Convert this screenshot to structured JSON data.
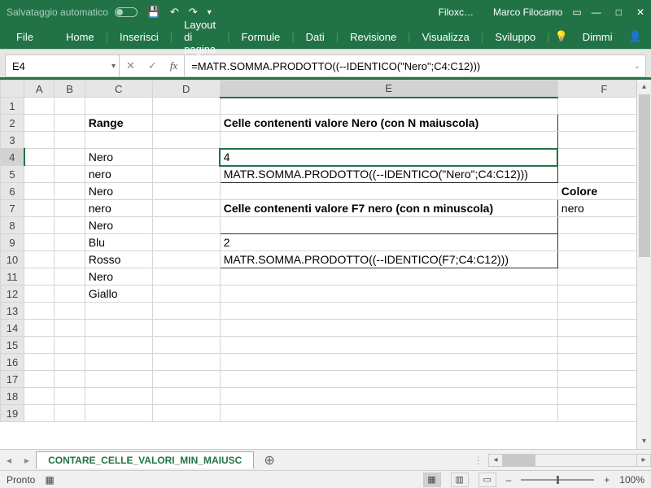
{
  "titlebar": {
    "autosave_label": "Salvataggio automatico",
    "doc_name": "Filoxc…",
    "user_name": "Marco Filocamo"
  },
  "ribbon": {
    "tabs": [
      "File",
      "Home",
      "Inserisci",
      "Layout di pagina",
      "Formule",
      "Dati",
      "Revisione",
      "Visualizza",
      "Sviluppo"
    ],
    "tellme": "Dimmi"
  },
  "formula_bar": {
    "name_box": "E4",
    "formula": "=MATR.SOMMA.PRODOTTO((--IDENTICO(\"Nero\";C4:C12)))"
  },
  "columns": [
    "A",
    "B",
    "C",
    "D",
    "E",
    "F"
  ],
  "cells": {
    "C2": "Range",
    "E2": "Celle contenenti valore Nero (con N maiuscola)",
    "C4": "Nero",
    "E4": "4",
    "C5": "nero",
    "E5": "MATR.SOMMA.PRODOTTO((--IDENTICO(\"Nero\";C4:C12)))",
    "C6": "Nero",
    "F6": "Colore",
    "C7": "nero",
    "E7": "Celle contenenti valore F7 nero (con n minuscola)",
    "F7": "nero",
    "C8": "Nero",
    "C9": "Blu",
    "E9": "2",
    "C10": "Rosso",
    "E10": "MATR.SOMMA.PRODOTTO((--IDENTICO(F7;C4:C12)))",
    "C11": "Nero",
    "C12": "Giallo"
  },
  "sheet_tab": "CONTARE_CELLE_VALORI_MIN_MAIUSC",
  "status": {
    "ready": "Pronto",
    "zoom": "100%"
  }
}
